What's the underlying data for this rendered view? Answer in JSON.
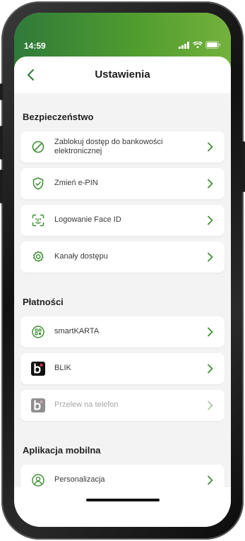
{
  "status": {
    "time": "14:59"
  },
  "header": {
    "title": "Ustawienia"
  },
  "sections": [
    {
      "title": "Bezpieczeństwo",
      "items": [
        {
          "label": "Zablokuj dostęp do bankowości elektronicznej",
          "icon": "block-icon"
        },
        {
          "label": "Zmień e-PIN",
          "icon": "shield-check-icon"
        },
        {
          "label": "Logowanie Face ID",
          "icon": "face-id-icon"
        },
        {
          "label": "Kanały dostępu",
          "icon": "gear-icon"
        }
      ]
    },
    {
      "title": "Płatności",
      "items": [
        {
          "label": "smartKARTA",
          "icon": "smartkarta-icon"
        },
        {
          "label": "BLIK",
          "icon": "blik-icon"
        },
        {
          "label": "Przelew na telefon",
          "icon": "blik-phone-icon",
          "disabled": true
        }
      ]
    },
    {
      "title": "Aplikacja mobilna",
      "items": [
        {
          "label": "Personalizacja",
          "icon": "person-icon"
        }
      ]
    }
  ],
  "colors": {
    "accent": "#3f8f34",
    "header_start": "#2f7a3a",
    "header_end": "#74b13c",
    "disabled": "#a7a7a7"
  }
}
